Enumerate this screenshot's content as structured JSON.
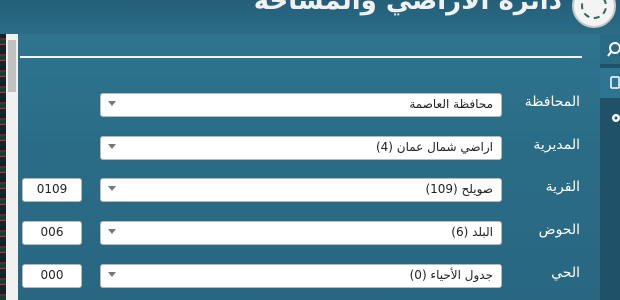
{
  "header": {
    "title": "دائرة الأراضي والمساحة"
  },
  "form": {
    "governorate": {
      "label": "المحافظة",
      "value": "محافظة العاصمة"
    },
    "directorate": {
      "label": "المديرية",
      "value": "اراضي شمال عمان (4)"
    },
    "village": {
      "label": "القرية",
      "value": "صويلح (109)",
      "code": "0109"
    },
    "basin": {
      "label": "الحوض",
      "value": "البلد (6)",
      "code": "006"
    },
    "neighborhood": {
      "label": "الحي",
      "value": "جدول الأحياء (0)",
      "code": "000"
    }
  },
  "sidebar": {
    "icons": [
      "search-icon",
      "document-icon",
      "location-icon"
    ]
  },
  "colors": {
    "background": "#2a6f8a",
    "sidebar": "#1f5268",
    "field": "#ffffff"
  }
}
